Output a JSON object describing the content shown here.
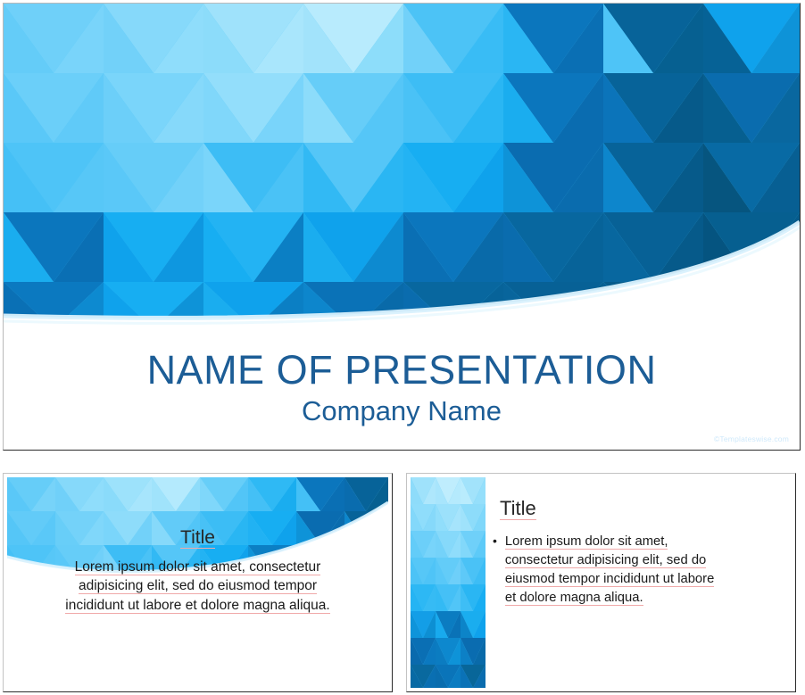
{
  "main_slide": {
    "title": "NAME OF PRESENTATION",
    "subtitle": "Company Name",
    "watermark": "©Templateswise.com",
    "colors": {
      "title_text": "#1c5d96",
      "subtitle_text": "#1c5d96",
      "watermark_text": "#cfe9fb",
      "slide_background": "#ffffff"
    }
  },
  "thumbnail_left": {
    "layout_name": "title-and-centered-text",
    "title": "Title",
    "body": "Lorem ipsum dolor sit amet, consectetur adipisicing elit, sed do eiusmod tempor incididunt ut labore et dolore magna aliqua.",
    "body_lines": [
      "Lorem ipsum dolor sit amet, consectetur",
      "adipisicing elit, sed do eiusmod tempor",
      "incididunt ut labore et dolore magna aliqua."
    ]
  },
  "thumbnail_right": {
    "layout_name": "title-and-bulleted-text",
    "title": "Title",
    "bullet_marker": "•",
    "body": "Lorem ipsum dolor sit amet, consectetur adipisicing elit, sed do eiusmod tempor incididunt ut labore et dolore magna aliqua.",
    "body_lines": [
      "Lorem ipsum dolor sit amet,",
      "consectetur adipisicing elit, sed do",
      "eiusmod tempor incididunt ut labore",
      "et dolore magna aliqua."
    ]
  },
  "theme": {
    "palette": {
      "lightest": "#bfe7fb",
      "light": "#8fd6fa",
      "mid_light": "#66cdf8",
      "mid": "#3cbdf5",
      "accent": "#17aef2",
      "strong": "#0e97e0",
      "deep": "#0f7fc4",
      "deeper": "#0b6cae",
      "darkest": "#075d98",
      "highlight_arc": "#d9f1fd"
    }
  }
}
